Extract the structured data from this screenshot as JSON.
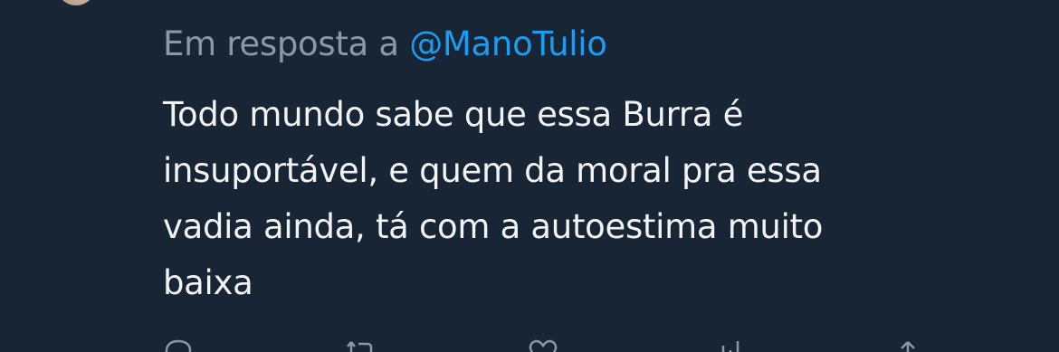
{
  "reply": {
    "prefix": "Em resposta a",
    "handle": "@ManoTulio"
  },
  "tweet": {
    "line_1": "Todo mundo sabe que essa Burra é",
    "line_2": "insuportável, e quem da moral pra essa",
    "line_3": "vadia ainda, tá com a autoestima muito",
    "line_4": "baixa"
  },
  "actions": [
    {
      "icon": "reply-icon"
    },
    {
      "icon": "retweet-icon"
    },
    {
      "icon": "like-icon"
    },
    {
      "icon": "views-icon"
    },
    {
      "icon": "share-icon"
    }
  ],
  "colors": {
    "background": "#172535",
    "muted_text": "#8b98a5",
    "link": "#1d9bf0",
    "text": "#f1f3f4"
  }
}
